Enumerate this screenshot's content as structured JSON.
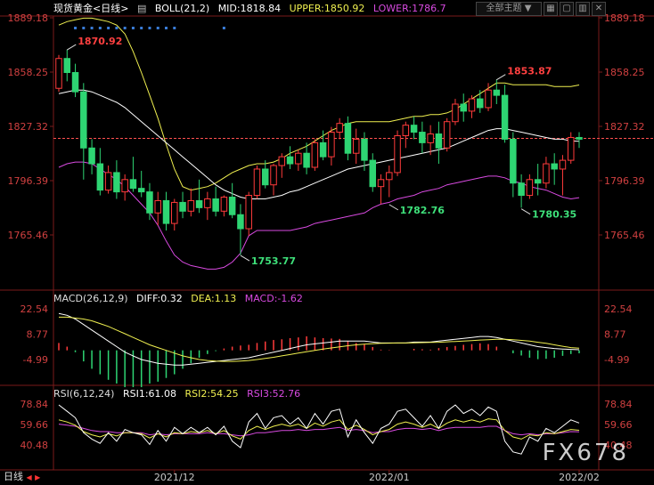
{
  "header": {
    "instrument": "现货黄金<日线>",
    "boll_label": "BOLL(21,2)",
    "mid": "MID:1818.84",
    "upper": "UPPER:1850.92",
    "lower": "LOWER:1786.7",
    "theme_button": "全部主题",
    "theme_arrow": "▼"
  },
  "macd_header": {
    "label": "MACD(26,12,9)",
    "diff": "DIFF:0.32",
    "dea": "DEA:1.13",
    "macd": "MACD:-1.62"
  },
  "rsi_header": {
    "label": "RSI(6,12,24)",
    "rsi1": "RSI1:61.08",
    "rsi2": "RSI2:54.25",
    "rsi3": "RSI3:52.76"
  },
  "bottom_tab": "日线",
  "watermark": "FX678",
  "colors": {
    "up": "#ff3b3b",
    "down": "#2ed573",
    "mid": "#ffffff",
    "upper": "#f0f050",
    "lower": "#d84ae0",
    "rsi1": "#ffffff",
    "rsi2": "#f0f050",
    "rsi3": "#d84ae0",
    "price_line": "#ff5050"
  },
  "chart_data": {
    "type": "candlestick",
    "price_ticks": [
      "1889.18",
      "1858.25",
      "1827.32",
      "1796.39",
      "1765.46"
    ],
    "price_tick_values": [
      1889.18,
      1858.25,
      1827.32,
      1796.39,
      1765.46
    ],
    "macd_ticks": [
      "22.54",
      "8.77",
      "-4.99"
    ],
    "macd_tick_values": [
      22.54,
      8.77,
      -4.99
    ],
    "rsi_ticks": [
      "78.84",
      "59.66",
      "40.48"
    ],
    "rsi_tick_values": [
      78.84,
      59.66,
      40.48
    ],
    "x_labels": [
      {
        "label": "2021/12",
        "index": 14
      },
      {
        "label": "2022/01",
        "index": 40
      },
      {
        "label": "2022/02",
        "index": 63
      }
    ],
    "annotations": [
      {
        "label": "1870.92",
        "index": 1,
        "value": 1870.92,
        "kind": "high"
      },
      {
        "label": "1753.77",
        "index": 22,
        "value": 1753.77,
        "kind": "low"
      },
      {
        "label": "1782.76",
        "index": 40,
        "value": 1782.76,
        "kind": "low"
      },
      {
        "label": "1853.87",
        "index": 53,
        "value": 1853.87,
        "kind": "high"
      },
      {
        "label": "1780.35",
        "index": 56,
        "value": 1780.35,
        "kind": "low"
      }
    ],
    "current_price": 1820.5,
    "ohlc": [
      [
        1849,
        1868,
        1847,
        1866
      ],
      [
        1866,
        1871,
        1853,
        1858
      ],
      [
        1858,
        1863,
        1844,
        1847
      ],
      [
        1847,
        1852,
        1797,
        1815
      ],
      [
        1815,
        1820,
        1800,
        1806
      ],
      [
        1806,
        1815,
        1788,
        1791
      ],
      [
        1791,
        1805,
        1789,
        1801
      ],
      [
        1801,
        1808,
        1786,
        1790
      ],
      [
        1790,
        1800,
        1785,
        1797
      ],
      [
        1797,
        1810,
        1790,
        1792
      ],
      [
        1792,
        1802,
        1787,
        1790
      ],
      [
        1790,
        1795,
        1774,
        1778
      ],
      [
        1778,
        1790,
        1771,
        1785
      ],
      [
        1785,
        1790,
        1768,
        1772
      ],
      [
        1772,
        1786,
        1768,
        1784
      ],
      [
        1784,
        1790,
        1775,
        1779
      ],
      [
        1779,
        1792,
        1776,
        1785
      ],
      [
        1785,
        1797,
        1778,
        1781
      ],
      [
        1781,
        1790,
        1774,
        1786
      ],
      [
        1786,
        1793,
        1776,
        1779
      ],
      [
        1779,
        1788,
        1776,
        1787
      ],
      [
        1787,
        1795,
        1775,
        1777
      ],
      [
        1777,
        1783,
        1754,
        1769
      ],
      [
        1769,
        1790,
        1765,
        1788
      ],
      [
        1788,
        1805,
        1786,
        1803
      ],
      [
        1803,
        1808,
        1792,
        1794
      ],
      [
        1794,
        1806,
        1788,
        1805
      ],
      [
        1805,
        1812,
        1798,
        1810
      ],
      [
        1810,
        1816,
        1803,
        1806
      ],
      [
        1806,
        1814,
        1802,
        1812
      ],
      [
        1812,
        1818,
        1800,
        1804
      ],
      [
        1804,
        1820,
        1802,
        1818
      ],
      [
        1818,
        1825,
        1808,
        1810
      ],
      [
        1810,
        1827,
        1805,
        1824
      ],
      [
        1824,
        1832,
        1820,
        1829
      ],
      [
        1829,
        1833,
        1808,
        1812
      ],
      [
        1812,
        1826,
        1806,
        1820
      ],
      [
        1820,
        1824,
        1802,
        1808
      ],
      [
        1808,
        1812,
        1790,
        1793
      ],
      [
        1793,
        1800,
        1783,
        1797
      ],
      [
        1797,
        1805,
        1787,
        1801
      ],
      [
        1801,
        1825,
        1799,
        1822
      ],
      [
        1822,
        1830,
        1815,
        1828
      ],
      [
        1828,
        1833,
        1820,
        1824
      ],
      [
        1824,
        1830,
        1812,
        1818
      ],
      [
        1818,
        1828,
        1811,
        1823
      ],
      [
        1823,
        1830,
        1806,
        1815
      ],
      [
        1815,
        1832,
        1813,
        1830
      ],
      [
        1830,
        1843,
        1828,
        1840
      ],
      [
        1840,
        1846,
        1830,
        1836
      ],
      [
        1836,
        1845,
        1832,
        1843
      ],
      [
        1843,
        1848,
        1835,
        1838
      ],
      [
        1838,
        1852,
        1836,
        1848
      ],
      [
        1848,
        1854,
        1840,
        1845
      ],
      [
        1845,
        1851,
        1818,
        1820
      ],
      [
        1820,
        1824,
        1787,
        1795
      ],
      [
        1795,
        1800,
        1781,
        1788
      ],
      [
        1788,
        1800,
        1786,
        1797
      ],
      [
        1797,
        1806,
        1788,
        1795
      ],
      [
        1795,
        1810,
        1792,
        1806
      ],
      [
        1806,
        1812,
        1794,
        1803
      ],
      [
        1803,
        1811,
        1788,
        1808
      ],
      [
        1808,
        1824,
        1806,
        1821
      ],
      [
        1821,
        1824,
        1815,
        1820
      ]
    ],
    "boll_mid": [
      1846,
      1847,
      1848,
      1848,
      1847,
      1845,
      1843,
      1841,
      1838,
      1834,
      1830,
      1826,
      1822,
      1818,
      1814,
      1810,
      1806,
      1802,
      1798,
      1794,
      1791,
      1789,
      1787,
      1786,
      1786,
      1786,
      1787,
      1788,
      1790,
      1791,
      1793,
      1795,
      1797,
      1799,
      1801,
      1803,
      1804,
      1805,
      1806,
      1807,
      1808,
      1809,
      1810,
      1811,
      1812,
      1813,
      1814,
      1815,
      1817,
      1819,
      1821,
      1823,
      1825,
      1826,
      1826,
      1825,
      1824,
      1823,
      1822,
      1821,
      1820,
      1820,
      1819,
      1818.84
    ],
    "boll_upper": [
      1885,
      1887,
      1888,
      1889,
      1889,
      1888,
      1887,
      1885,
      1880,
      1870,
      1858,
      1845,
      1832,
      1817,
      1803,
      1793,
      1791,
      1792,
      1793,
      1795,
      1798,
      1801,
      1803,
      1805,
      1806,
      1806,
      1807,
      1809,
      1812,
      1814,
      1816,
      1819,
      1822,
      1825,
      1827,
      1829,
      1830,
      1830,
      1830,
      1830,
      1830,
      1831,
      1832,
      1833,
      1833,
      1834,
      1834,
      1835,
      1837,
      1840,
      1843,
      1846,
      1849,
      1852,
      1852,
      1851,
      1851,
      1851,
      1851,
      1851,
      1850,
      1850,
      1850,
      1850.92
    ],
    "boll_lower": [
      1804,
      1806,
      1807,
      1807,
      1806,
      1803,
      1800,
      1797,
      1793,
      1788,
      1783,
      1778,
      1771,
      1762,
      1754,
      1750,
      1748,
      1747,
      1746,
      1746,
      1747,
      1750,
      1755,
      1765,
      1768,
      1768,
      1768,
      1768,
      1768,
      1769,
      1770,
      1772,
      1773,
      1774,
      1775,
      1776,
      1777,
      1778,
      1781,
      1783,
      1784,
      1786,
      1787,
      1788,
      1790,
      1791,
      1792,
      1794,
      1795,
      1796,
      1797,
      1798,
      1799,
      1799,
      1798,
      1796,
      1795,
      1793,
      1792,
      1791,
      1789,
      1787,
      1786,
      1786.7
    ],
    "macd_diff": [
      20,
      19,
      17,
      14,
      11,
      8,
      5,
      2,
      -1,
      -3,
      -5,
      -6,
      -7,
      -7.5,
      -8,
      -8,
      -7.5,
      -7,
      -6.5,
      -6,
      -5.5,
      -5,
      -4.5,
      -4,
      -3,
      -2,
      -1,
      0,
      1,
      2,
      3,
      3.5,
      4,
      4.5,
      5,
      5,
      5,
      5,
      4.5,
      4,
      4,
      4,
      4,
      4.5,
      4.5,
      4.5,
      5,
      5.5,
      6,
      6.5,
      7,
      7.5,
      7.5,
      7,
      6,
      5,
      4,
      3,
      2,
      1.5,
      1,
      0.7,
      0.5,
      0.32
    ],
    "macd_dea": [
      18,
      18,
      17.5,
      17,
      16,
      14.5,
      13,
      11,
      9,
      7,
      5,
      3,
      1.5,
      0,
      -1.5,
      -3,
      -4,
      -5,
      -5.5,
      -5.8,
      -6,
      -6,
      -5.8,
      -5.5,
      -5,
      -4.4,
      -3.8,
      -3,
      -2.3,
      -1.5,
      -0.8,
      0,
      0.7,
      1.3,
      1.9,
      2.5,
      3,
      3.3,
      3.6,
      3.8,
      3.9,
      4,
      4,
      4.1,
      4.2,
      4.3,
      4.4,
      4.6,
      4.8,
      5,
      5.3,
      5.6,
      5.8,
      6,
      6,
      5.8,
      5.4,
      5,
      4.4,
      3.8,
      3,
      2.2,
      1.5,
      1.13
    ],
    "macd_hist": [
      4,
      2,
      -1,
      -6,
      -10,
      -13,
      -16,
      -18,
      -20,
      -20,
      -20,
      -18,
      -17,
      -15,
      -13,
      -10,
      -7,
      -4,
      -2,
      -0.4,
      1,
      2,
      2.6,
      3,
      4,
      4.8,
      5.6,
      6,
      6.6,
      7,
      7.6,
      7,
      6.6,
      6.4,
      6.2,
      5,
      4,
      3.4,
      1.8,
      0.4,
      0.2,
      0,
      0,
      0.8,
      0.6,
      0.4,
      1.2,
      1.8,
      2.4,
      3,
      3.4,
      3.8,
      3.4,
      2,
      0,
      -1.6,
      -2.8,
      -4,
      -4.8,
      -4.6,
      -4,
      -3,
      -2,
      -1.62
    ],
    "rsi1": [
      78,
      72,
      66,
      52,
      46,
      42,
      52,
      44,
      55,
      52,
      50,
      41,
      54,
      44,
      57,
      51,
      57,
      52,
      57,
      50,
      58,
      44,
      38,
      62,
      70,
      56,
      66,
      68,
      60,
      66,
      56,
      70,
      60,
      72,
      74,
      48,
      64,
      52,
      42,
      56,
      60,
      72,
      74,
      66,
      58,
      68,
      56,
      72,
      78,
      70,
      74,
      68,
      76,
      72,
      44,
      34,
      32,
      48,
      44,
      56,
      52,
      58,
      64,
      61.08
    ],
    "rsi2": [
      64,
      62,
      59,
      53,
      50,
      48,
      51,
      49,
      52,
      52,
      51,
      47,
      51,
      48,
      52,
      51,
      53,
      52,
      54,
      51,
      54,
      49,
      46,
      54,
      58,
      55,
      58,
      60,
      58,
      60,
      56,
      61,
      58,
      62,
      64,
      55,
      59,
      55,
      50,
      53,
      55,
      60,
      62,
      60,
      57,
      60,
      56,
      61,
      64,
      62,
      64,
      62,
      65,
      64,
      54,
      48,
      46,
      50,
      49,
      52,
      51,
      53,
      55,
      54.25
    ],
    "rsi3": [
      60,
      59,
      58,
      56,
      54,
      53,
      53,
      52,
      52,
      52,
      52,
      50,
      51,
      50,
      51,
      51,
      51,
      51,
      52,
      51,
      51,
      50,
      49,
      50,
      52,
      52,
      53,
      54,
      54,
      55,
      54,
      55,
      55,
      56,
      57,
      54,
      55,
      54,
      52,
      53,
      53,
      55,
      56,
      56,
      55,
      56,
      54,
      56,
      57,
      57,
      57,
      57,
      58,
      58,
      54,
      51,
      50,
      51,
      50,
      51,
      51,
      52,
      53,
      52.76
    ]
  }
}
